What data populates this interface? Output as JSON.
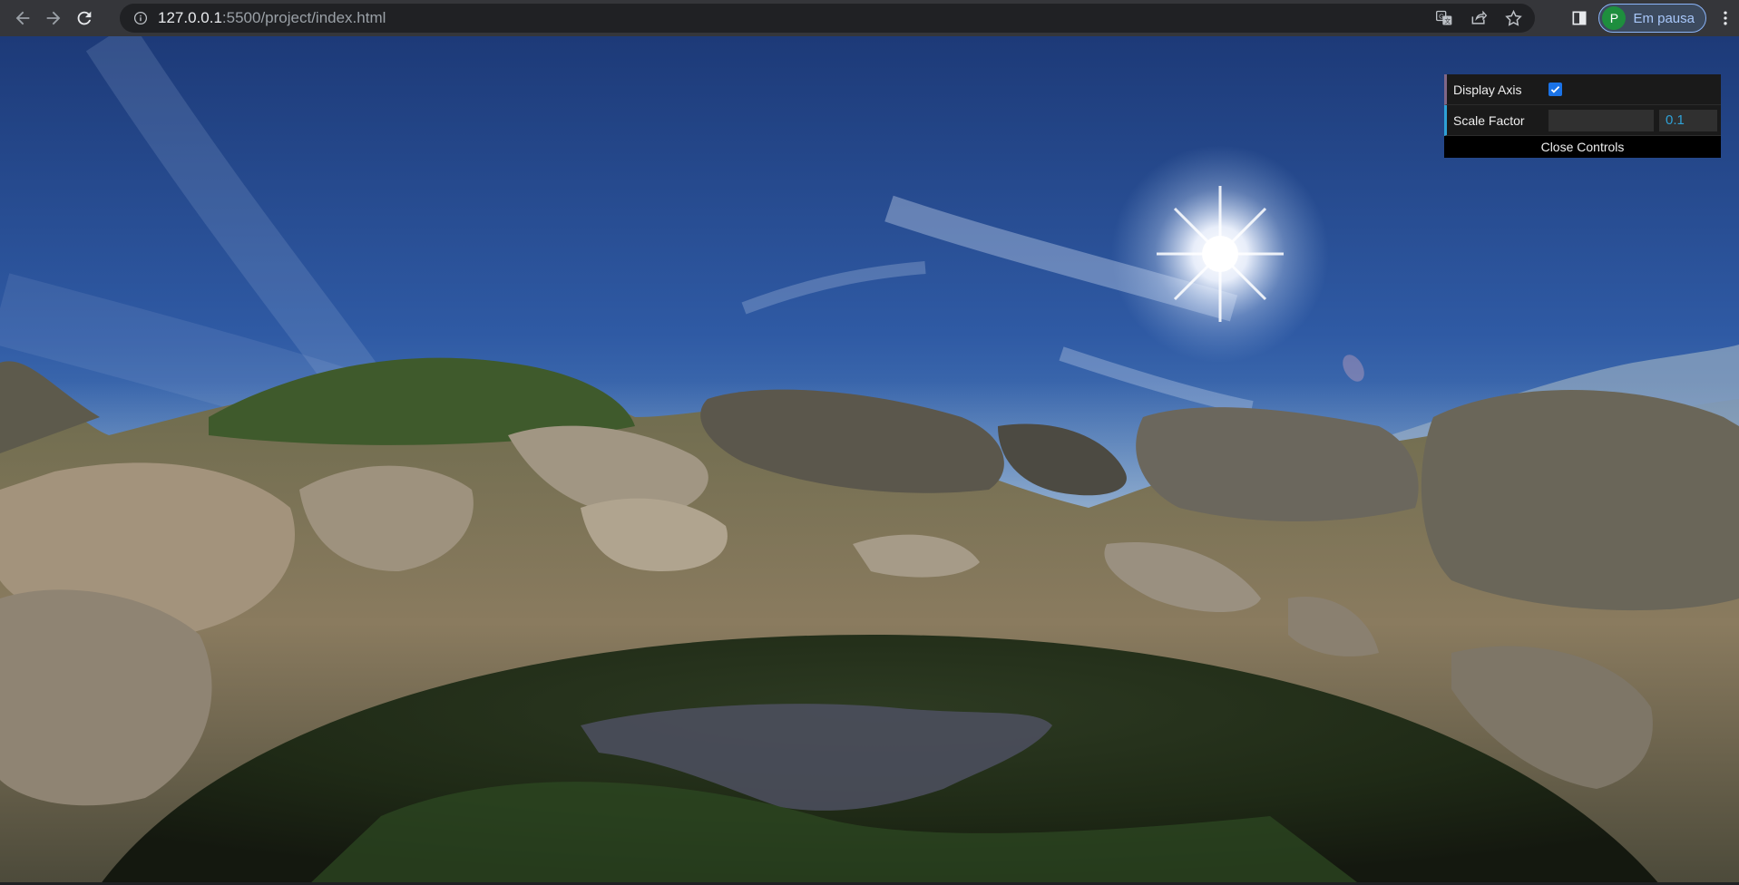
{
  "browser": {
    "url_host": "127.0.0.1",
    "url_path": ":5500/project/index.html",
    "profile_initial": "P",
    "profile_status": "Em pausa",
    "icons": {
      "back": "back-arrow-icon",
      "forward": "forward-arrow-icon",
      "reload": "reload-icon",
      "site_info": "info-icon",
      "translate": "translate-icon",
      "share": "share-icon",
      "bookmark": "star-icon",
      "side_panel": "side-panel-icon",
      "menu": "kebab-menu-icon"
    },
    "colors": {
      "toolbar": "#35363a",
      "omnibox": "#202124",
      "profile_accent": "#8ab4f8",
      "avatar": "#1e8e3e"
    }
  },
  "gui": {
    "display_axis_label": "Display Axis",
    "display_axis_checked": true,
    "scale_factor_label": "Scale Factor",
    "scale_factor_value": "0.1",
    "close_label": "Close Controls",
    "colors": {
      "panel": "#1a1a1a",
      "number_accent": "#2fa1d6",
      "boolean_accent": "#806787"
    }
  },
  "scene": {
    "description_icons": [
      "sun-flare",
      "mountains",
      "rocks",
      "ground-sphere"
    ]
  }
}
